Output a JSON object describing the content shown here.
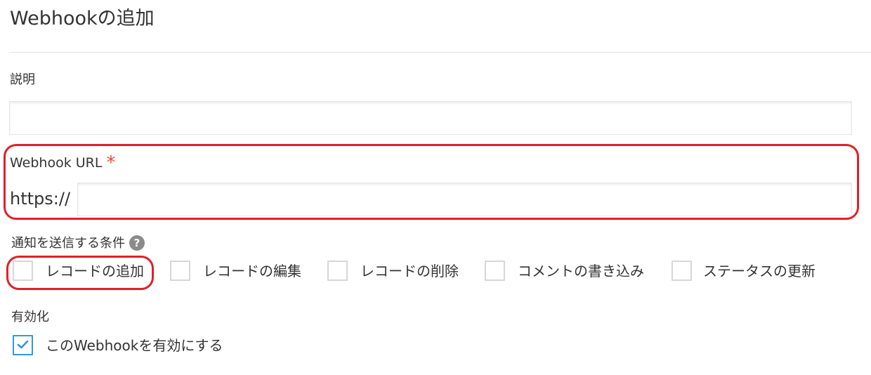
{
  "page": {
    "title": "Webhookの追加"
  },
  "description": {
    "label": "説明",
    "value": "",
    "placeholder": ""
  },
  "webhook_url": {
    "label": "Webhook URL",
    "required_mark": "*",
    "prefix": "https://",
    "value": "",
    "placeholder": ""
  },
  "conditions": {
    "label": "通知を送信する条件",
    "help_icon": "question-circle-icon",
    "options": [
      {
        "label": "レコードの追加",
        "checked": false
      },
      {
        "label": "レコードの編集",
        "checked": false
      },
      {
        "label": "レコードの削除",
        "checked": false
      },
      {
        "label": "コメントの書き込み",
        "checked": false
      },
      {
        "label": "ステータスの更新",
        "checked": false
      }
    ]
  },
  "enable": {
    "label": "有効化",
    "option_label": "このWebhookを有効にする",
    "checked": true
  },
  "colors": {
    "highlight": "#e0202a",
    "required": "#e74c3c",
    "checkbox_checked": "#3498db"
  }
}
